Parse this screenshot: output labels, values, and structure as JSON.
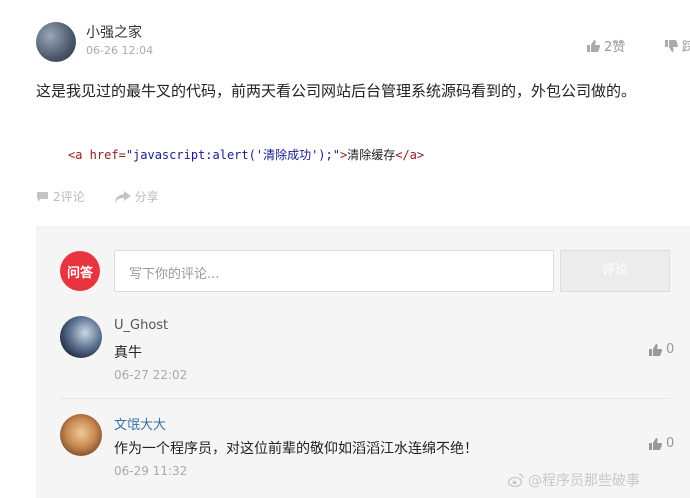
{
  "post": {
    "author": "小强之家",
    "date": "06-26 12:04",
    "like_label": "2赞",
    "dislike_label": "踩",
    "text": "这是我见过的最牛叉的代码，前两天看公司网站后台管理系统源码看到的，外包公司做的。",
    "code": {
      "tag_open": "<a",
      "attr": " href=",
      "value": "\"javascript:alert('清除成功');\"",
      "close": ">",
      "link_text": "清除缓存",
      "tag_end": "</a>"
    },
    "comment_count": "2评论",
    "share_label": "分享"
  },
  "comment_box": {
    "logo_text": "问答",
    "placeholder": "写下你的评论...",
    "submit_label": "评论"
  },
  "comments": [
    {
      "name": "U_Ghost",
      "body": "真牛",
      "time": "06-27 22:02",
      "likes": "0"
    },
    {
      "name": "文氓大大",
      "body": "作为一个程序员，对这位前辈的敬仰如滔滔江水连绵不绝！",
      "time": "06-29 11:32",
      "likes": "0"
    }
  ],
  "watermark": "@程序员那些破事"
}
